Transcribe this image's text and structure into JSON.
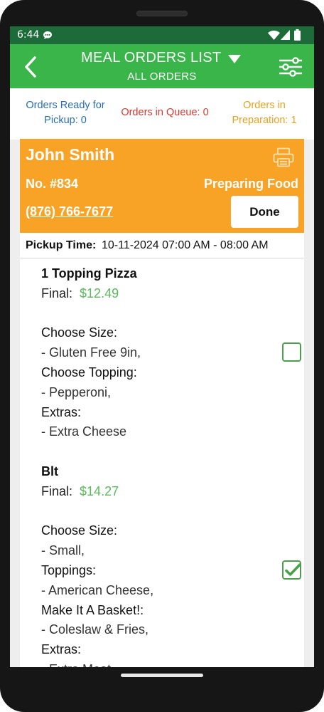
{
  "status_bar": {
    "time": "6:44"
  },
  "header": {
    "title": "MEAL ORDERS LIST",
    "subtitle": "ALL ORDERS"
  },
  "summary": {
    "ready": "Orders Ready for Pickup: 0",
    "queue": "Orders in Queue: 0",
    "preparation": "Orders in Preparation: 1"
  },
  "order": {
    "customer_name": "John Smith",
    "number": "No. #834",
    "status": "Preparing Food",
    "phone": "(876) 766-7677",
    "done_label": "Done",
    "pickup_label": "Pickup Time:",
    "pickup_value": "10-11-2024 07:00 AM - 08:00 AM",
    "items": [
      {
        "name": "1 Topping Pizza",
        "final_label": "Final:",
        "price": "$12.49",
        "checked": false,
        "options": [
          {
            "label": "Choose Size:",
            "value": "- Gluten Free 9in,"
          },
          {
            "label": "Choose Topping:",
            "value": "- Pepperoni,"
          },
          {
            "label": "Extras:",
            "value": "- Extra Cheese"
          }
        ]
      },
      {
        "name": "Blt",
        "final_label": "Final:",
        "price": "$14.27",
        "checked": true,
        "options": [
          {
            "label": "Choose Size:",
            "value": "- Small,"
          },
          {
            "label": "Toppings:",
            "value": "- American Cheese,"
          },
          {
            "label": "Make It A Basket!:",
            "value": "- Coleslaw & Fries,"
          },
          {
            "label": "Extras:",
            "value": "- Extra Meat"
          }
        ]
      }
    ]
  },
  "colors": {
    "header_green": "#39b54a",
    "status_bar_green": "#1e6b3a",
    "order_orange": "#f8a325",
    "price_green": "#5cb85c",
    "ready_blue": "#2a6db0",
    "queue_red": "#d33a32",
    "prep_orange": "#e6a120"
  }
}
